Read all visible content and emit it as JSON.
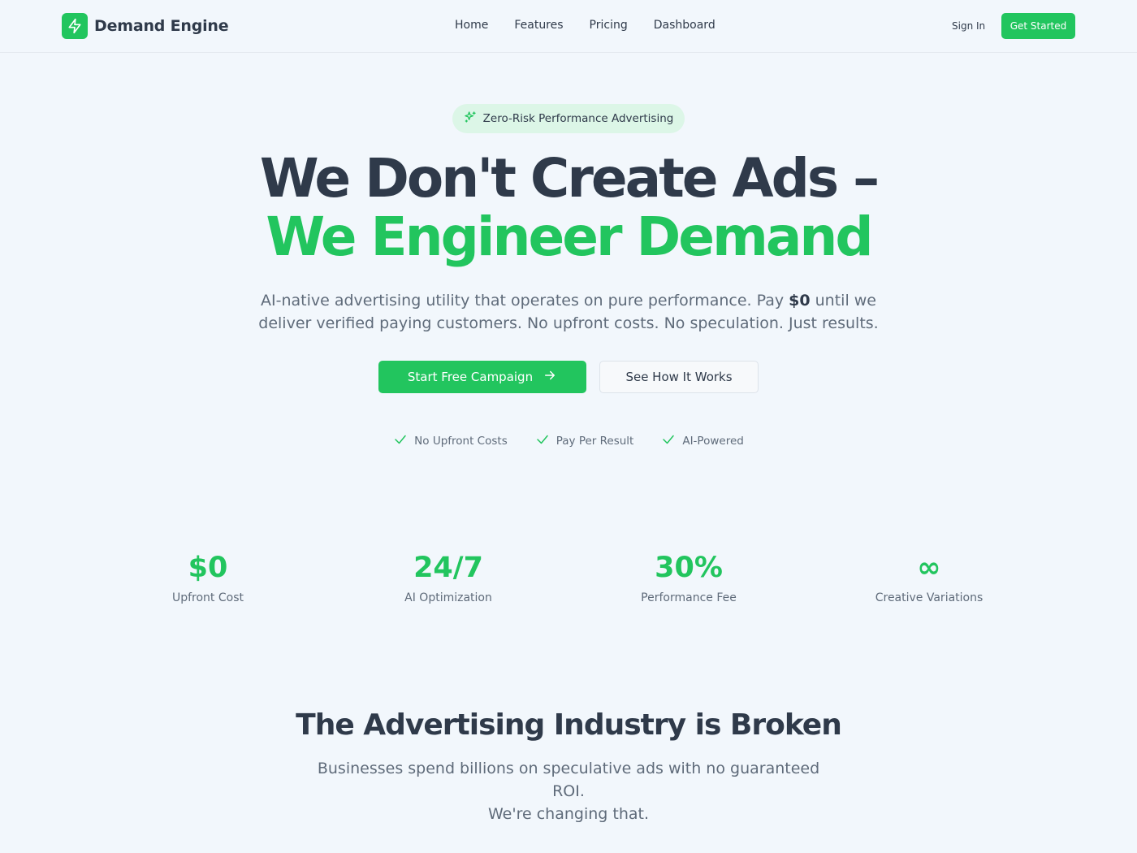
{
  "brand": {
    "name": "Demand Engine",
    "accent": "#22c55e"
  },
  "nav": {
    "items": [
      {
        "label": "Home"
      },
      {
        "label": "Features"
      },
      {
        "label": "Pricing"
      },
      {
        "label": "Dashboard"
      }
    ],
    "sign_in": "Sign In",
    "get_started": "Get Started"
  },
  "hero": {
    "badge": "Zero-Risk Performance Advertising",
    "title_line1": "We Don't Create Ads –",
    "title_line2": "We Engineer Demand",
    "subtitle_before": "AI-native advertising utility that operates on pure performance. Pay ",
    "subtitle_bold": "$0",
    "subtitle_after": " until we deliver verified paying customers. No upfront costs. No speculation. Just results.",
    "primary_cta": "Start Free Campaign",
    "secondary_cta": "See How It Works",
    "checks": [
      {
        "label": "No Upfront Costs"
      },
      {
        "label": "Pay Per Result"
      },
      {
        "label": "AI-Powered"
      }
    ]
  },
  "stats": [
    {
      "value": "$0",
      "label": "Upfront Cost"
    },
    {
      "value": "24/7",
      "label": "AI Optimization"
    },
    {
      "value": "30%",
      "label": "Performance Fee"
    },
    {
      "value": "∞",
      "label": "Creative Variations"
    }
  ],
  "section": {
    "title": "The Advertising Industry is Broken",
    "subtitle_line1": "Businesses spend billions on speculative ads with no guaranteed ROI.",
    "subtitle_line2": "We're changing that."
  }
}
